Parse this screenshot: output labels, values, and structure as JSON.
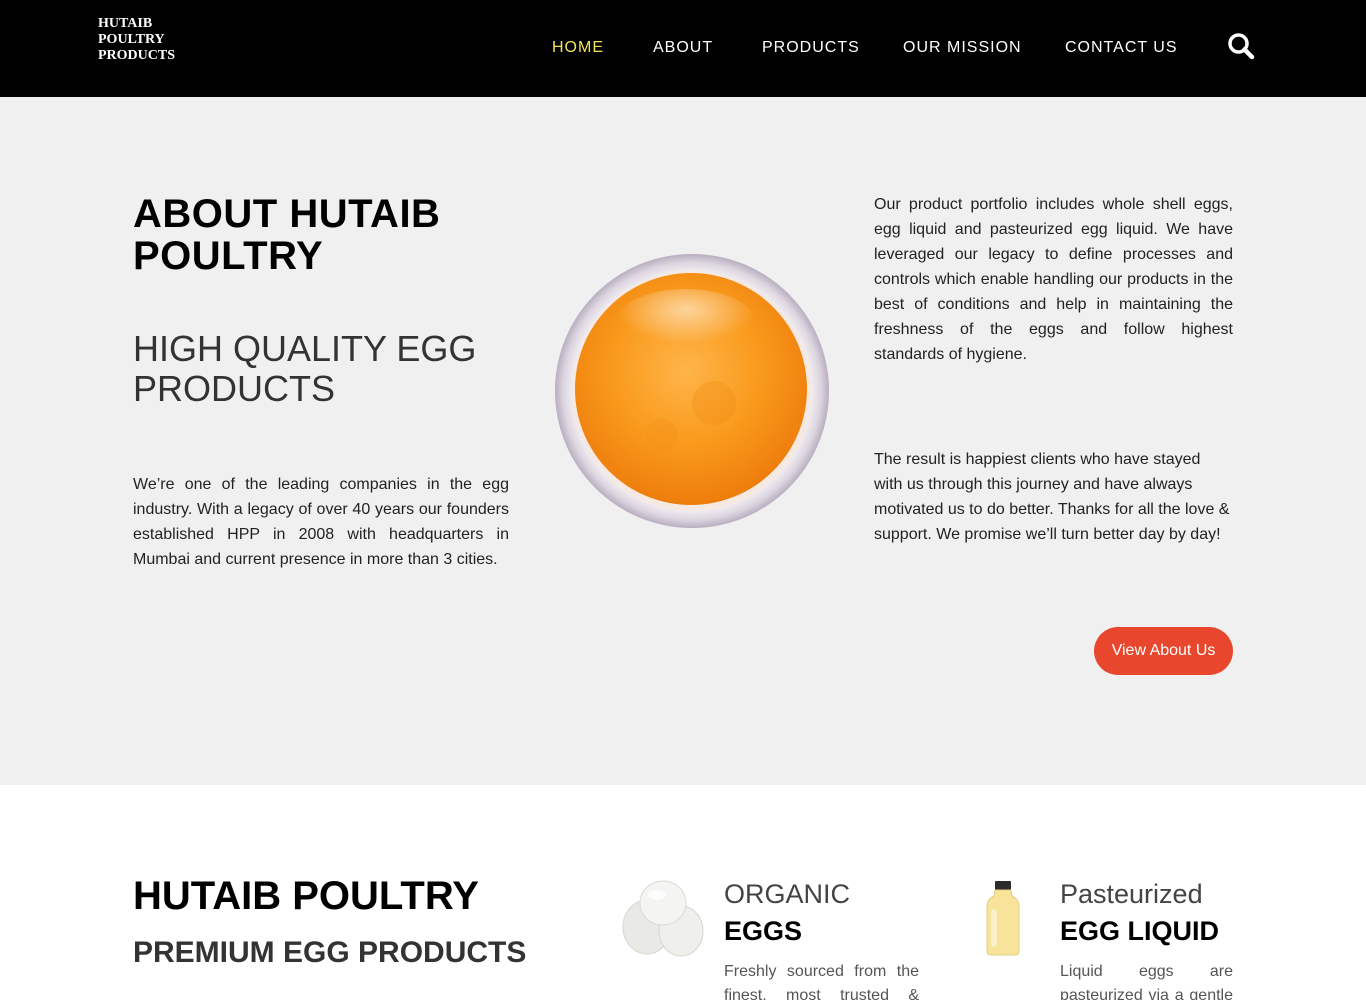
{
  "header": {
    "logo_lines": [
      "HUTAIB",
      "POULTRY",
      "PRODUCTS"
    ],
    "nav": [
      "HOME",
      "ABOUT",
      "PRODUCTS",
      "OUR MISSION",
      "CONTACT US"
    ],
    "active_nav": "HOME",
    "search_icon": "search-icon"
  },
  "about": {
    "title": "ABOUT HUTAIB POULTRY",
    "subtitle": "HIGH QUALITY EGG PRODUCTS",
    "intro": "We’re one of the leading companies in the egg industry. With a legacy of over 40 years our founders established HPP in 2008 with headquarters in Mumbai and current presence in more than 3 cities.",
    "paragraph1": "Our product portfolio includes whole shell eggs, egg liquid and pasteurized egg liquid. We have leveraged our legacy to define processes and controls which enable handling our products in the best of conditions and help in maintaining the freshness of the eggs and follow highest standards of hygiene.",
    "paragraph2": "The result is happiest clients who have stayed with us through this journey and have always motivated us to do better. Thanks for all the love & support. We promise we’ll turn better day by day!",
    "button_label": "View About Us"
  },
  "products": {
    "title": "HUTAIB POULTRY",
    "subtitle": "PREMIUM EGG PRODUCTS",
    "cards": [
      {
        "kicker": "ORGANIC",
        "heading": "EGGS",
        "text": "Freshly sourced from the finest, most trusted & hygienic farms"
      },
      {
        "kicker": "Pasteurized",
        "heading": "EGG LIQUID",
        "text": "Liquid eggs are pasteurized via a gentle heat process"
      }
    ]
  },
  "colors": {
    "header_bg": "#000000",
    "nav_active": "#f2e35c",
    "about_bg": "#f0f0f0",
    "button_bg": "#e8462d"
  }
}
